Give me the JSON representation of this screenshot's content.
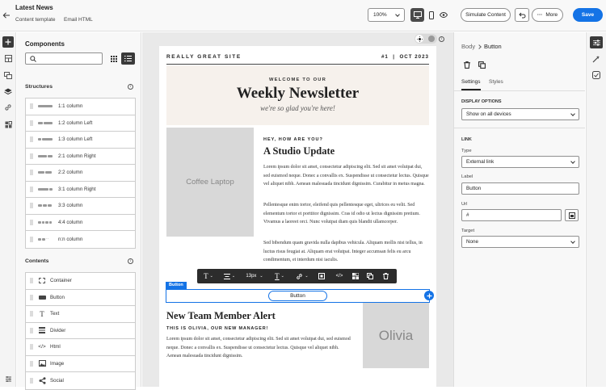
{
  "header": {
    "title": "Latest News",
    "breadcrumb": [
      "Content template",
      "Email HTML"
    ],
    "zoom": "100%",
    "simulate_label": "Simulate Content",
    "more_label": "More",
    "save_label": "Save"
  },
  "left_panel": {
    "title": "Components",
    "search_placeholder": "",
    "structures_title": "Structures",
    "structures": [
      "1:1 column",
      "1:2 column Left",
      "1:3 column Left",
      "2:1 column Right",
      "2:2 column",
      "3:1 column Right",
      "3:3 column",
      "4:4 column",
      "n:n column"
    ],
    "contents_title": "Contents",
    "contents": [
      {
        "label": "Container",
        "icon": "container-icon"
      },
      {
        "label": "Button",
        "icon": "button-icon"
      },
      {
        "label": "Text",
        "icon": "text-icon"
      },
      {
        "label": "Divider",
        "icon": "divider-icon"
      },
      {
        "label": "Html",
        "icon": "code-icon"
      },
      {
        "label": "Image",
        "icon": "image-icon"
      },
      {
        "label": "Social",
        "icon": "share-icon"
      }
    ]
  },
  "email": {
    "site": "REALLY GREAT SITE",
    "issue": "#1  |  OCT 2023",
    "welcome": "WELCOME TO OUR",
    "title": "Weekly Newsletter",
    "tagline": "we're so glad you're here!",
    "image1_label": "Coffee Laptop",
    "kicker": "HEY, HOW ARE YOU?",
    "update_title": "A Studio Update",
    "p1": "Lorem ipsum dolor sit amet, consectetur adipiscing elit. Sed sit amet volutpat dui, sed euismod neque. Donec a convallis ex. Suspendisse ut consectetur lectus. Quisque vel aliquet nibh. Aenean malesuada tincidunt dignissim. Curabitur in metus magna.",
    "p2": "Pellentesque enim tortor, eleifend quis pellentesque eget, ultrices eu velit. Sed elementum tortor et porttitor dignissim. Cras id odio ut lectus dignissim pretium. Vivamus a laoreet orci. Nunc volutpat diam quis blandit ullamcorper.",
    "p3": "Sed bibendum quam gravida nulla dapibus vehicula. Aliquam mollis nisi tellus, in luctus risus feugiat at. Aliquam erat volutpat. Integer accumsan felis eu arcu condimentum, et interdum nisi iaculis.",
    "button_tag": "Button",
    "button_label": "Button",
    "font_size": "13px",
    "alert_title": "New Team Member Alert",
    "alert_kicker": "THIS IS OLIVIA, OUR NEW MANAGER!",
    "alert_p": "Lorem ipsum dolor sit amet, consectetur adipiscing elit. Sed sit amet volutpat dui, sed euismod neque. Donec a convallis ex. Suspendisse ut consectetur lectus. Quisque vel aliquet nibh. Aenean malesuada tincidunt dignissim.",
    "image2_label": "Olivia"
  },
  "right_panel": {
    "breadcrumb_root": "Body",
    "breadcrumb_current": "Button",
    "tab_settings": "Settings",
    "tab_styles": "Styles",
    "display_title": "DISPLAY OPTIONS",
    "display_value": "Show on all devices",
    "link_title": "LINK",
    "type_label": "Type",
    "type_value": "External link",
    "label_label": "Label",
    "label_value": "Button",
    "url_label": "Url",
    "url_value": "#",
    "target_label": "Target",
    "target_value": "None"
  },
  "colors": {
    "accent": "#1473e6",
    "toolbar": "#2c2c2c",
    "hero_bg": "#f6f1ec"
  }
}
